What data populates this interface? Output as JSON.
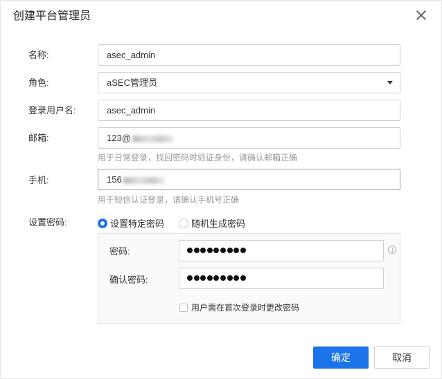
{
  "dialog": {
    "title": "创建平台管理员",
    "close_icon": "close-icon"
  },
  "form": {
    "name": {
      "label": "名称:",
      "value": "asec_admin"
    },
    "role": {
      "label": "角色:",
      "value": "aSEC管理员"
    },
    "username": {
      "label": "登录用户名:",
      "value": "asec_admin"
    },
    "email": {
      "label": "邮箱:",
      "value": "123@",
      "hint": "用于日常登录，找回密码时验证身份，请确认邮箱正确"
    },
    "phone": {
      "label": "手机:",
      "value": "156",
      "hint": "用于短信认证登录，请确认手机号正确"
    },
    "password_mode": {
      "label": "设置密码:",
      "options": [
        {
          "label": "设置特定密码",
          "checked": true
        },
        {
          "label": "随机生成密码",
          "checked": false
        }
      ]
    },
    "password": {
      "label": "密码:"
    },
    "confirm_password": {
      "label": "确认密码:"
    },
    "force_change": {
      "label": "用户需在首次登录时更改密码",
      "checked": false
    }
  },
  "footer": {
    "ok_label": "确定",
    "cancel_label": "取消"
  },
  "colors": {
    "primary": "#1a73e8",
    "hint": "#999999"
  }
}
